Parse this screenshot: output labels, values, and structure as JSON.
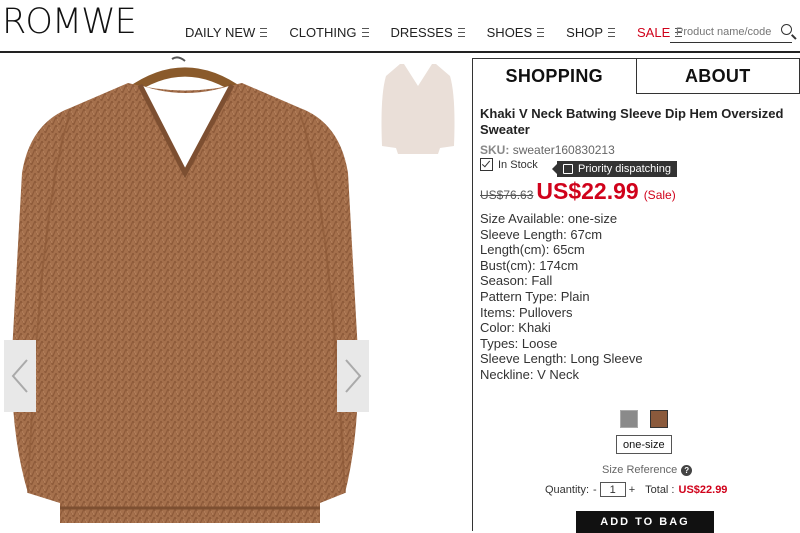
{
  "header": {
    "logo": "ROMWE",
    "nav": [
      {
        "label": "DAILY NEW"
      },
      {
        "label": "CLOTHING"
      },
      {
        "label": "DRESSES"
      },
      {
        "label": "SHOES"
      },
      {
        "label": "SHOP"
      },
      {
        "label": "SALE"
      }
    ],
    "search_placeholder": "Product name/code"
  },
  "tabs": {
    "shopping": "SHOPPING",
    "about": "ABOUT"
  },
  "product": {
    "title": "Khaki V Neck Batwing Sleeve Dip Hem Oversized Sweater",
    "sku_label": "SKU:",
    "sku": "sweater160830213",
    "stock": "In Stock",
    "priority": "Priority dispatching",
    "old_price": "US$76.63",
    "price": "US$22.99",
    "sale_tag": "(Sale)",
    "specs": [
      "Size Available: one-size",
      "Sleeve Length: 67cm",
      "Length(cm): 65cm",
      "Bust(cm): 174cm",
      "Season: Fall",
      "Pattern Type: Plain",
      "Items: Pullovers",
      "Color: Khaki",
      "Types: Loose",
      "Sleeve Length: Long Sleeve",
      "Neckline: V Neck"
    ],
    "size_button": "one-size",
    "size_reference": "Size Reference",
    "quantity_label": "Quantity:",
    "quantity": "1",
    "minus": "-",
    "plus": "+",
    "total_label": "Total :",
    "total": "US$22.99",
    "add_to_bag": "ADD TO BAG"
  },
  "colors": {
    "accent_red": "#d0021b",
    "sweater": "#a8714d"
  }
}
